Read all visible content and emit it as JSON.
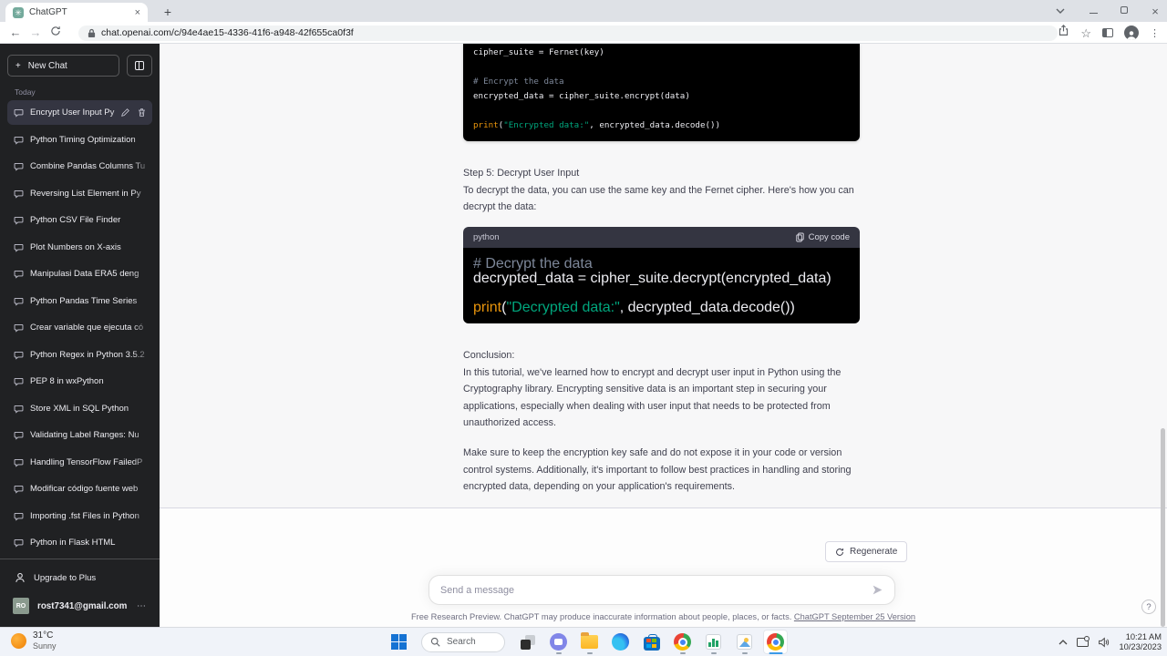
{
  "browser": {
    "tab_title": "ChatGPT",
    "url": "chat.openai.com/c/94e4ae15-4336-41f6-a948-42f655ca0f3f"
  },
  "icons": {
    "new_tab": "+",
    "tab_close": "×",
    "window_close": "×",
    "back": "←",
    "forward": "→",
    "bookmark_star": "☆",
    "menu_dots": "⋮",
    "account_dots": "⋯",
    "new_chat_plus": "+",
    "help": "?"
  },
  "sidebar": {
    "new_chat_label": "New Chat",
    "section_label": "Today",
    "items": [
      {
        "label": "Encrypt User Input Py",
        "active": true
      },
      {
        "label": "Python Timing Optimization",
        "active": false
      },
      {
        "label": "Combine Pandas Columns Tu",
        "active": false
      },
      {
        "label": "Reversing List Element in Py",
        "active": false
      },
      {
        "label": "Python CSV File Finder",
        "active": false
      },
      {
        "label": "Plot Numbers on X-axis",
        "active": false
      },
      {
        "label": "Manipulasi Data ERA5 deng",
        "active": false
      },
      {
        "label": "Python Pandas Time Series",
        "active": false
      },
      {
        "label": "Crear variable que ejecuta có",
        "active": false
      },
      {
        "label": "Python Regex in Python 3.5.2",
        "active": false
      },
      {
        "label": "PEP 8 in wxPython",
        "active": false
      },
      {
        "label": "Store XML in SQL Python",
        "active": false
      },
      {
        "label": "Validating Label Ranges: Nu",
        "active": false
      },
      {
        "label": "Handling TensorFlow FailedP",
        "active": false
      },
      {
        "label": "Modificar código fuente web",
        "active": false
      },
      {
        "label": "Importing .fst Files in Python",
        "active": false
      },
      {
        "label": "Python in Flask HTML",
        "active": false
      }
    ],
    "upgrade_label": "Upgrade to Plus",
    "account": {
      "initials": "RO",
      "email": "rost7341@gmail.com"
    }
  },
  "chat": {
    "code1": {
      "line1": "cipher_suite = Fernet(key)",
      "comment": "# Encrypt the data",
      "line3": "encrypted_data = cipher_suite.encrypt(data)",
      "print_fn": "print",
      "print_open": "(",
      "print_str": "\"Encrypted data:\"",
      "print_rest": ", encrypted_data.decode())"
    },
    "step5_heading": "Step 5: Decrypt User Input",
    "step5_body": "To decrypt the data, you can use the same key and the Fernet cipher. Here's how you can decrypt the data:",
    "code2": {
      "lang": "python",
      "copy_label": "Copy code",
      "comment": "# Decrypt the data",
      "line2": "decrypted_data = cipher_suite.decrypt(encrypted_data)",
      "print_fn": "print",
      "print_open": "(",
      "print_str": "\"Decrypted data:\"",
      "print_rest": ", decrypted_data.decode())"
    },
    "conclusion_heading": "Conclusion:",
    "conclusion_p1": "In this tutorial, we've learned how to encrypt and decrypt user input in Python using the Cryptography library. Encrypting sensitive data is an important step in securing your applications, especially when dealing with user input that needs to be protected from unauthorized access.",
    "conclusion_p2": "Make sure to keep the encryption key safe and do not expose it in your code or version control systems. Additionally, it's important to follow best practices in handling and storing encrypted data, depending on your application's requirements."
  },
  "composer": {
    "regenerate_label": "Regenerate",
    "input_placeholder": "Send a message",
    "footer_text": "Free Research Preview. ChatGPT may produce inaccurate information about people, places, or facts. ",
    "footer_link": "ChatGPT September 25 Version"
  },
  "taskbar": {
    "search_placeholder": "Search",
    "weather": {
      "temp": "31°C",
      "condition": "Sunny"
    },
    "clock": {
      "time": "10:21 AM",
      "date": "10/23/2023"
    }
  },
  "colors": {
    "sidebar_bg": "#202123",
    "active_item_bg": "#343541",
    "assistant_msg_bg": "#f7f7f8",
    "code_bg": "#000000",
    "code_string": "#00a67d",
    "code_function": "#e9950c",
    "accent_taskbar_indicator": "#3b9ae8"
  }
}
